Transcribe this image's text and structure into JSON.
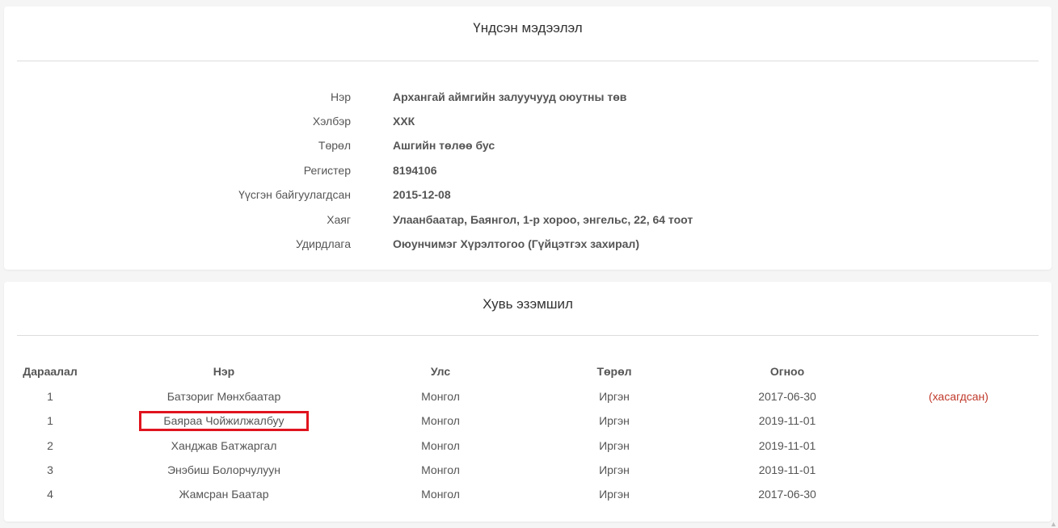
{
  "basic_info": {
    "title": "Үндсэн мэдээлэл",
    "rows": [
      {
        "label": "Нэр",
        "value": "Архангай аймгийн залуучууд оюутны төв"
      },
      {
        "label": "Хэлбэр",
        "value": "ХХК"
      },
      {
        "label": "Төрөл",
        "value": "Ашгийн төлөө бус"
      },
      {
        "label": "Регистер",
        "value": "8194106"
      },
      {
        "label": "Үүсгэн байгуулагдсан",
        "value": "2015-12-08"
      },
      {
        "label": "Хаяг",
        "value": "Улаанбаатар, Баянгол, 1-р хороо, энгельс, 22, 64 тоот"
      },
      {
        "label": "Удирдлага",
        "value": "Оюунчимэг Хүрэлтогоо (Гүйцэтгэх захирал)"
      }
    ]
  },
  "ownership": {
    "title": "Хувь эзэмшил",
    "headers": {
      "seq": "Дараалал",
      "name": "Нэр",
      "country": "Улс",
      "type": "Төрөл",
      "date": "Огноо"
    },
    "rows": [
      {
        "seq": "1",
        "name": "Батзориг Мөнхбаатар",
        "country": "Монгол",
        "type": "Иргэн",
        "date": "2017-06-30",
        "note": "(хасагдсан)"
      },
      {
        "seq": "1",
        "name": "Баяраа Чойжилжалбуу",
        "country": "Монгол",
        "type": "Иргэн",
        "date": "2019-11-01",
        "note": ""
      },
      {
        "seq": "2",
        "name": "Ханджав Батжаргал",
        "country": "Монгол",
        "type": "Иргэн",
        "date": "2019-11-01",
        "note": ""
      },
      {
        "seq": "3",
        "name": "Энэбиш Болорчулуун",
        "country": "Монгол",
        "type": "Иргэн",
        "date": "2019-11-01",
        "note": ""
      },
      {
        "seq": "4",
        "name": "Жамсран Баатар",
        "country": "Монгол",
        "type": "Иргэн",
        "date": "2017-06-30",
        "note": ""
      }
    ]
  },
  "colors": {
    "removed_text": "#c8c8c8",
    "removed_note": "#c0392b",
    "highlight_border": "#e0141e"
  }
}
